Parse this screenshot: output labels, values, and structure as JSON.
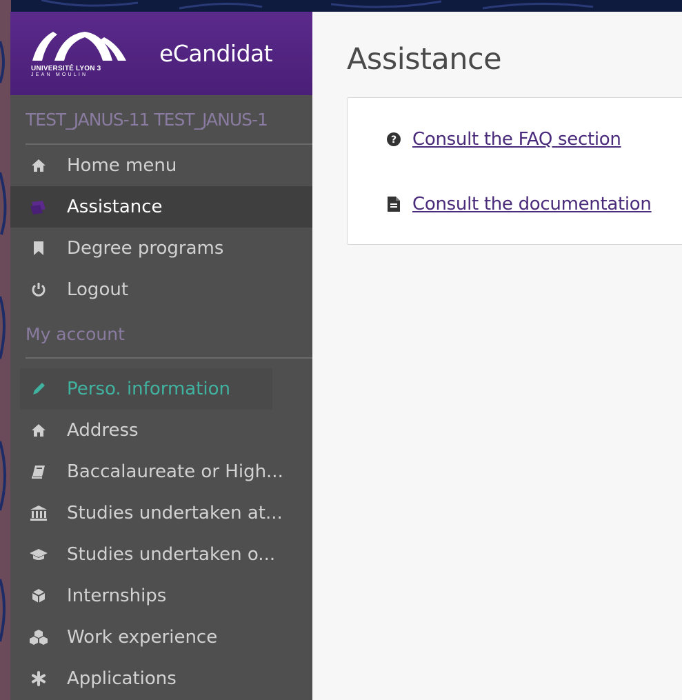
{
  "app": {
    "name": "eCandidat",
    "logo_line1": "UNIVERSITÉ LYON 3",
    "logo_line2": "JEAN MOULIN"
  },
  "user": {
    "name": "TEST_JANUS-11 TEST_JANUS-1"
  },
  "nav": {
    "items": [
      {
        "label": "Home menu",
        "icon": "home-icon"
      },
      {
        "label": "Assistance",
        "icon": "support-icon",
        "active": true
      },
      {
        "label": "Degree programs",
        "icon": "bookmark-icon"
      },
      {
        "label": "Logout",
        "icon": "power-icon"
      }
    ]
  },
  "account": {
    "title": "My account",
    "items": [
      {
        "label": "Perso. information",
        "icon": "pencil-icon"
      },
      {
        "label": "Address",
        "icon": "home-icon"
      },
      {
        "label": "Baccalaureate or High...",
        "icon": "book-icon"
      },
      {
        "label": "Studies undertaken at...",
        "icon": "institution-icon"
      },
      {
        "label": "Studies undertaken o...",
        "icon": "graduation-cap-icon"
      },
      {
        "label": "Internships",
        "icon": "cube-icon"
      },
      {
        "label": "Work experience",
        "icon": "cubes-icon"
      },
      {
        "label": "Applications",
        "icon": "asterisk-icon"
      }
    ]
  },
  "main": {
    "title": "Assistance",
    "links": [
      {
        "label": "Consult the FAQ section",
        "icon": "question-circle-icon"
      },
      {
        "label": "Consult the documentation",
        "icon": "file-text-icon"
      }
    ]
  },
  "colors": {
    "brand_purple": "#5b2a8c",
    "sidebar_bg": "#4f4f4f",
    "active_bg": "#3f3f3f",
    "highlight_teal": "#40b3a0",
    "link_purple": "#4a2a7a",
    "muted_purple": "#8a7ba0"
  }
}
